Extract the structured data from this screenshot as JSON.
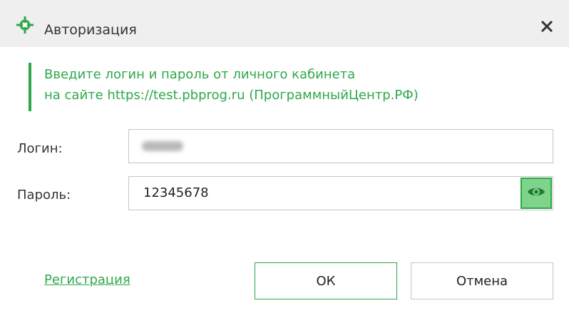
{
  "window": {
    "title": "Авторизация",
    "icon": "green-target-icon",
    "close_icon": "close-icon"
  },
  "info": {
    "line1": "Введите логин и пароль от личного кабинета",
    "line2": "на сайте https://test.pbprog.ru (ПрограммныйЦентр.РФ)"
  },
  "form": {
    "login_label": "Логин:",
    "login_value_redacted": true,
    "password_label": "Пароль:",
    "password_value": "12345678",
    "show_password_icon": "eye-icon"
  },
  "footer": {
    "register_link": "Регистрация",
    "ok_label": "ОК",
    "cancel_label": "Отмена"
  },
  "colors": {
    "accent": "#2ea84a",
    "accent_light": "#7ed48a",
    "titlebar_bg": "#efefef"
  }
}
